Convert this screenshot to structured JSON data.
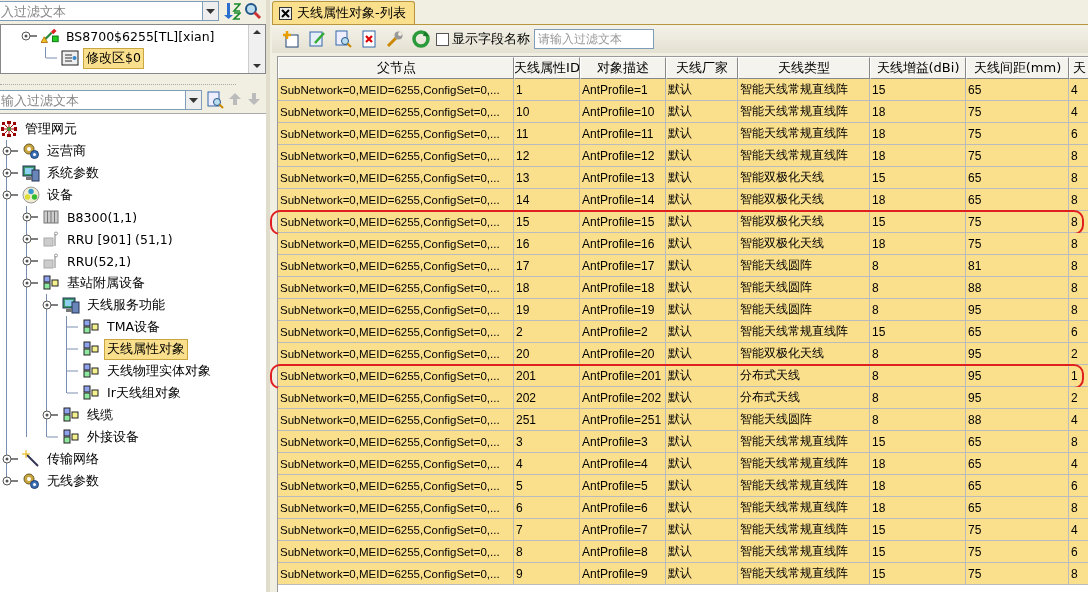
{
  "left_panel": {
    "top_filter": {
      "placeholder": "入过滤文本"
    },
    "top_tree": [
      {
        "label": "BS8700$6255[TL][xian]",
        "kind": "station",
        "selected": false,
        "expandable": true,
        "children": [
          {
            "label": "修改区$0",
            "kind": "doc",
            "selected": true,
            "expandable": false
          }
        ]
      }
    ],
    "filter": {
      "placeholder": "输入过滤文本"
    },
    "tree": [
      {
        "label": "管理网元",
        "kind": "root",
        "selected": false,
        "expandable": false,
        "children": [
          {
            "label": "运营商",
            "kind": "gear",
            "selected": false,
            "expandable": true
          },
          {
            "label": "系统参数",
            "kind": "system",
            "selected": false,
            "expandable": true
          },
          {
            "label": "设备",
            "kind": "device",
            "selected": false,
            "expandable": true,
            "children": [
              {
                "label": "B8300(1,1)",
                "kind": "rack",
                "selected": false,
                "expandable": true
              },
              {
                "label": "RRU [901] (51,1)",
                "kind": "rru",
                "selected": false,
                "expandable": true
              },
              {
                "label": "RRU(52,1)",
                "kind": "rru",
                "selected": false,
                "expandable": true
              },
              {
                "label": "基站附属设备",
                "kind": "group",
                "selected": false,
                "expandable": true,
                "children": [
                  {
                    "label": "天线服务功能",
                    "kind": "system",
                    "selected": false,
                    "expandable": true,
                    "children": [
                      {
                        "label": "TMA设备",
                        "kind": "group",
                        "selected": false,
                        "expandable": false
                      },
                      {
                        "label": "天线属性对象",
                        "kind": "group",
                        "selected": true,
                        "expandable": false
                      },
                      {
                        "label": "天线物理实体对象",
                        "kind": "group",
                        "selected": false,
                        "expandable": false
                      },
                      {
                        "label": "Ir天线组对象",
                        "kind": "group",
                        "selected": false,
                        "expandable": false
                      }
                    ]
                  },
                  {
                    "label": "线缆",
                    "kind": "group",
                    "selected": false,
                    "expandable": true
                  },
                  {
                    "label": "外接设备",
                    "kind": "group",
                    "selected": false,
                    "expandable": false
                  }
                ]
              }
            ]
          },
          {
            "label": "传输网络",
            "kind": "wand",
            "selected": false,
            "expandable": true
          },
          {
            "label": "无线参数",
            "kind": "gear",
            "selected": false,
            "expandable": true
          }
        ]
      }
    ]
  },
  "tab": {
    "label": "天线属性对象-列表",
    "selected": true
  },
  "toolbar": {
    "show_field_names": {
      "label": "显示字段名称",
      "checked": false
    },
    "filter": {
      "placeholder": "请输入过滤文本"
    }
  },
  "table": {
    "columns": [
      "父节点",
      "天线属性ID",
      "对象描述",
      "天线厂家",
      "天线类型",
      "天线增益(dBi)",
      "天线间距(mm)",
      "天"
    ],
    "rows": [
      {
        "circled": false,
        "cells": [
          "SubNetwork=0,MEID=6255,ConfigSet=0,...",
          "1",
          "AntProfile=1",
          "默认",
          "智能天线常规直线阵",
          "15",
          "65",
          "4"
        ]
      },
      {
        "circled": false,
        "cells": [
          "SubNetwork=0,MEID=6255,ConfigSet=0,...",
          "10",
          "AntProfile=10",
          "默认",
          "智能天线常规直线阵",
          "18",
          "75",
          "4"
        ]
      },
      {
        "circled": false,
        "cells": [
          "SubNetwork=0,MEID=6255,ConfigSet=0,...",
          "11",
          "AntProfile=11",
          "默认",
          "智能天线常规直线阵",
          "18",
          "75",
          "6"
        ]
      },
      {
        "circled": false,
        "cells": [
          "SubNetwork=0,MEID=6255,ConfigSet=0,...",
          "12",
          "AntProfile=12",
          "默认",
          "智能天线常规直线阵",
          "18",
          "75",
          "8"
        ]
      },
      {
        "circled": false,
        "cells": [
          "SubNetwork=0,MEID=6255,ConfigSet=0,...",
          "13",
          "AntProfile=13",
          "默认",
          "智能双极化天线",
          "15",
          "65",
          "8"
        ]
      },
      {
        "circled": false,
        "cells": [
          "SubNetwork=0,MEID=6255,ConfigSet=0,...",
          "14",
          "AntProfile=14",
          "默认",
          "智能双极化天线",
          "18",
          "65",
          "8"
        ]
      },
      {
        "circled": true,
        "cells": [
          "SubNetwork=0,MEID=6255,ConfigSet=0,...",
          "15",
          "AntProfile=15",
          "默认",
          "智能双极化天线",
          "15",
          "75",
          "8"
        ]
      },
      {
        "circled": false,
        "cells": [
          "SubNetwork=0,MEID=6255,ConfigSet=0,...",
          "16",
          "AntProfile=16",
          "默认",
          "智能双极化天线",
          "18",
          "75",
          "8"
        ]
      },
      {
        "circled": false,
        "cells": [
          "SubNetwork=0,MEID=6255,ConfigSet=0,...",
          "17",
          "AntProfile=17",
          "默认",
          "智能天线圆阵",
          "8",
          "81",
          "8"
        ]
      },
      {
        "circled": false,
        "cells": [
          "SubNetwork=0,MEID=6255,ConfigSet=0,...",
          "18",
          "AntProfile=18",
          "默认",
          "智能天线圆阵",
          "8",
          "88",
          "8"
        ]
      },
      {
        "circled": false,
        "cells": [
          "SubNetwork=0,MEID=6255,ConfigSet=0,...",
          "19",
          "AntProfile=19",
          "默认",
          "智能天线圆阵",
          "8",
          "95",
          "8"
        ]
      },
      {
        "circled": false,
        "cells": [
          "SubNetwork=0,MEID=6255,ConfigSet=0,...",
          "2",
          "AntProfile=2",
          "默认",
          "智能天线常规直线阵",
          "15",
          "65",
          "6"
        ]
      },
      {
        "circled": false,
        "cells": [
          "SubNetwork=0,MEID=6255,ConfigSet=0,...",
          "20",
          "AntProfile=20",
          "默认",
          "智能双极化天线",
          "8",
          "95",
          "2"
        ]
      },
      {
        "circled": true,
        "cells": [
          "SubNetwork=0,MEID=6255,ConfigSet=0,...",
          "201",
          "AntProfile=201",
          "默认",
          "分布式天线",
          "8",
          "95",
          "1"
        ]
      },
      {
        "circled": false,
        "cells": [
          "SubNetwork=0,MEID=6255,ConfigSet=0,...",
          "202",
          "AntProfile=202",
          "默认",
          "分布式天线",
          "8",
          "95",
          "2"
        ]
      },
      {
        "circled": false,
        "cells": [
          "SubNetwork=0,MEID=6255,ConfigSet=0,...",
          "251",
          "AntProfile=251",
          "默认",
          "智能天线圆阵",
          "8",
          "88",
          "4"
        ]
      },
      {
        "circled": false,
        "cells": [
          "SubNetwork=0,MEID=6255,ConfigSet=0,...",
          "3",
          "AntProfile=3",
          "默认",
          "智能天线常规直线阵",
          "15",
          "65",
          "8"
        ]
      },
      {
        "circled": false,
        "cells": [
          "SubNetwork=0,MEID=6255,ConfigSet=0,...",
          "4",
          "AntProfile=4",
          "默认",
          "智能天线常规直线阵",
          "18",
          "65",
          "4"
        ]
      },
      {
        "circled": false,
        "cells": [
          "SubNetwork=0,MEID=6255,ConfigSet=0,...",
          "5",
          "AntProfile=5",
          "默认",
          "智能天线常规直线阵",
          "18",
          "65",
          "6"
        ]
      },
      {
        "circled": false,
        "cells": [
          "SubNetwork=0,MEID=6255,ConfigSet=0,...",
          "6",
          "AntProfile=6",
          "默认",
          "智能天线常规直线阵",
          "18",
          "65",
          "8"
        ]
      },
      {
        "circled": false,
        "cells": [
          "SubNetwork=0,MEID=6255,ConfigSet=0,...",
          "7",
          "AntProfile=7",
          "默认",
          "智能天线常规直线阵",
          "15",
          "75",
          "4"
        ]
      },
      {
        "circled": false,
        "cells": [
          "SubNetwork=0,MEID=6255,ConfigSet=0,...",
          "8",
          "AntProfile=8",
          "默认",
          "智能天线常规直线阵",
          "15",
          "75",
          "6"
        ]
      },
      {
        "circled": false,
        "cells": [
          "SubNetwork=0,MEID=6255,ConfigSet=0,...",
          "9",
          "AntProfile=9",
          "默认",
          "智能天线常规直线阵",
          "15",
          "75",
          "8"
        ]
      }
    ]
  }
}
